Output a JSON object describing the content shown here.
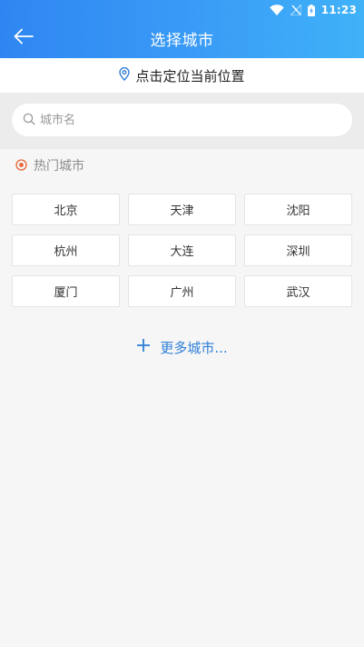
{
  "status_bar": {
    "time": "11:23",
    "icons": [
      "wifi-icon",
      "no-signal-icon",
      "battery-charging-icon"
    ]
  },
  "header": {
    "back_icon": "arrow-left-icon",
    "title": "选择城市"
  },
  "locate": {
    "icon": "location-pin-icon",
    "label": "点击定位当前位置"
  },
  "search": {
    "icon": "search-icon",
    "placeholder": "城市名",
    "value": ""
  },
  "hot_cities": {
    "icon": "target-dot-icon",
    "title": "热门城市",
    "cities": [
      {
        "label": "北京"
      },
      {
        "label": "天津"
      },
      {
        "label": "沈阳"
      },
      {
        "label": "杭州"
      },
      {
        "label": "大连"
      },
      {
        "label": "深圳"
      },
      {
        "label": "厦门"
      },
      {
        "label": "广州"
      },
      {
        "label": "武汉"
      }
    ]
  },
  "more": {
    "icon": "plus-icon",
    "label": "更多城市..."
  },
  "colors": {
    "header_gradient_start": "#2f86f2",
    "header_gradient_end": "#3fb2f8",
    "accent_blue": "#2f7fd8",
    "hot_icon": "#e8663a",
    "background": "#f6f6f6"
  }
}
